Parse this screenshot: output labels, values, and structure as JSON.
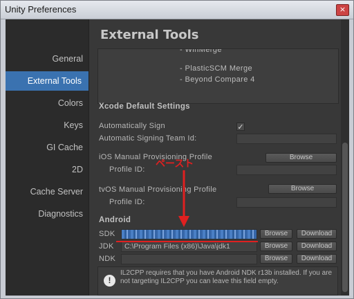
{
  "window": {
    "title": "Unity Preferences",
    "close_glyph": "×"
  },
  "sidebar": {
    "items": [
      {
        "label": "General",
        "active": false
      },
      {
        "label": "External Tools",
        "active": true
      },
      {
        "label": "Colors",
        "active": false
      },
      {
        "label": "Keys",
        "active": false
      },
      {
        "label": "GI Cache",
        "active": false
      },
      {
        "label": "2D",
        "active": false
      },
      {
        "label": "Cache Server",
        "active": false
      },
      {
        "label": "Diagnostics",
        "active": false
      }
    ]
  },
  "content": {
    "heading": "External Tools",
    "diff_tools": [
      "- WinMerge",
      "- PlasticSCM Merge",
      "- Beyond Compare 4"
    ],
    "xcode": {
      "section": "Xcode Default Settings",
      "auto_sign_label": "Automatically Sign",
      "auto_sign_checked": "✓",
      "team_id_label": "Automatic Signing Team Id:",
      "ios_profile_label": "iOS Manual Provisioning Profile",
      "ios_browse": "Browse",
      "ios_profile_id_label": "Profile ID:",
      "tvos_profile_label": "tvOS Manual Provisioning Profile",
      "tvos_browse": "Browse",
      "tvos_profile_id_label": "Profile ID:"
    },
    "android": {
      "section": "Android",
      "sdk_label": "SDK",
      "sdk_browse": "Browse",
      "sdk_download": "Download",
      "jdk_label": "JDK",
      "jdk_value": "C:\\Program Files (x86)\\Java\\jdk1",
      "jdk_browse": "Browse",
      "jdk_download": "Download",
      "ndk_label": "NDK",
      "ndk_browse": "Browse",
      "ndk_download": "Download"
    },
    "info": {
      "icon": "!",
      "text": "IL2CPP requires that you have Android NDK r13b installed. If you are not targeting IL2CPP you can leave this field empty."
    }
  },
  "annotation": {
    "text": "ペースト",
    "color": "#e02020"
  }
}
